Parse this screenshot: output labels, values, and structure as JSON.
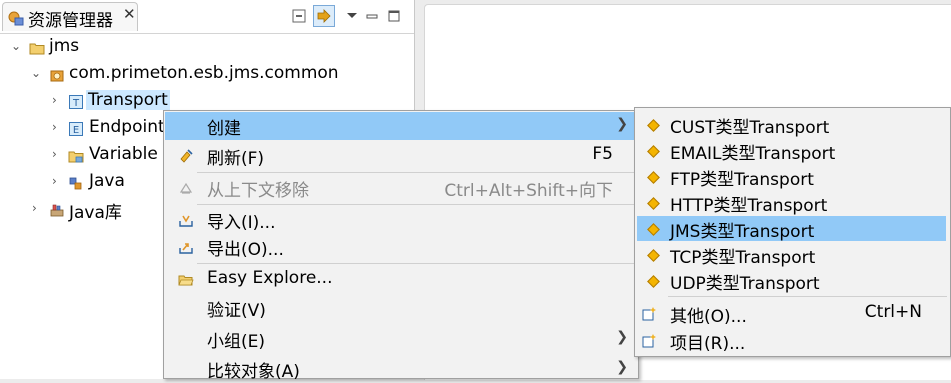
{
  "explorer": {
    "tab_title": "资源管理器",
    "close_glyph": "✕",
    "tree": [
      {
        "label": "jms",
        "expanded": true,
        "icon": "project-folder-icon"
      },
      {
        "label": "com.primeton.esb.jms.common",
        "expanded": true,
        "icon": "module-icon"
      },
      {
        "label": "Transport",
        "expanded": false,
        "icon": "transport-icon",
        "selected": true
      },
      {
        "label": "Endpoint",
        "expanded": false,
        "icon": "endpoint-icon"
      },
      {
        "label": "Variable",
        "expanded": false,
        "icon": "variable-folder-icon"
      },
      {
        "label": "Java",
        "expanded": false,
        "icon": "java-icon"
      },
      {
        "label": "Java库",
        "expanded": false,
        "icon": "library-icon"
      }
    ]
  },
  "context_menu": {
    "items": [
      {
        "label": "创建",
        "has_submenu": true,
        "icon": ""
      },
      {
        "label": "刷新(F)",
        "accel": "F5",
        "icon": "refresh-icon"
      },
      {
        "label": "从上下文移除",
        "accel": "Ctrl+Alt+Shift+向下",
        "disabled": true,
        "icon": "remove-context-icon"
      },
      {
        "label": "导入(I)...",
        "icon": "import-icon"
      },
      {
        "label": "导出(O)...",
        "icon": "export-icon"
      },
      {
        "label": "Easy Explore...",
        "icon": "folder-open-icon"
      },
      {
        "label": "验证(V)",
        "icon": ""
      },
      {
        "label": "小组(E)",
        "has_submenu": true,
        "icon": ""
      },
      {
        "label": "比较对象(A)",
        "has_submenu": true,
        "icon": ""
      }
    ]
  },
  "submenu": {
    "items": [
      {
        "label": "CUST类型Transport"
      },
      {
        "label": "EMAIL类型Transport"
      },
      {
        "label": "FTP类型Transport"
      },
      {
        "label": "HTTP类型Transport"
      },
      {
        "label": "JMS类型Transport"
      },
      {
        "label": "TCP类型Transport"
      },
      {
        "label": "UDP类型Transport"
      }
    ],
    "other_label": "其他(O)...",
    "other_accel": "Ctrl+N",
    "project_label": "项目(R)..."
  },
  "colors": {
    "hover": "#91c9f7",
    "selection": "#cce8ff",
    "diamond": "#f4b400"
  }
}
